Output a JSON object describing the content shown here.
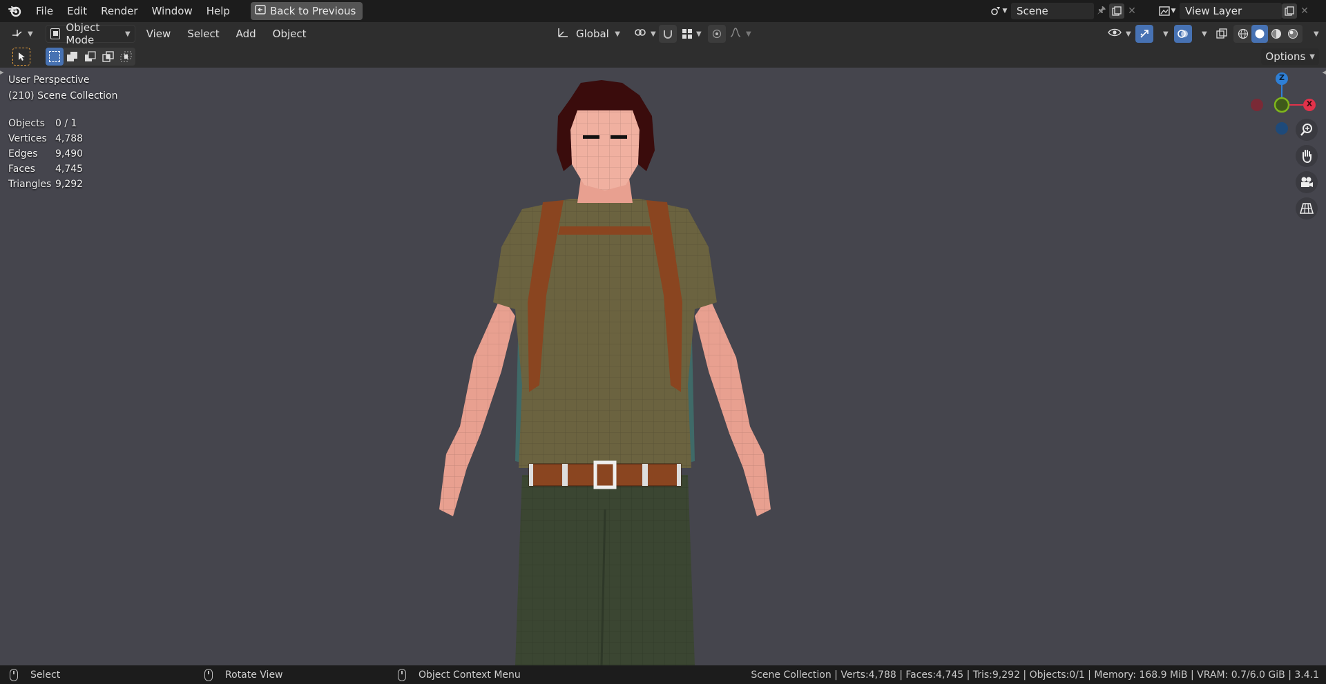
{
  "menu": {
    "items": [
      "File",
      "Edit",
      "Render",
      "Window",
      "Help"
    ],
    "back_label": "Back to Previous"
  },
  "scene": {
    "name": "Scene",
    "view_layer": "View Layer"
  },
  "header": {
    "mode": "Object Mode",
    "menus": [
      "View",
      "Select",
      "Add",
      "Object"
    ],
    "orientation": "Global",
    "options_label": "Options"
  },
  "viewport": {
    "perspective": "User Perspective",
    "collection": "(210) Scene Collection",
    "stats": [
      {
        "k": "Objects",
        "v": "0 / 1"
      },
      {
        "k": "Vertices",
        "v": "4,788"
      },
      {
        "k": "Edges",
        "v": "9,490"
      },
      {
        "k": "Faces",
        "v": "4,745"
      },
      {
        "k": "Triangles",
        "v": "9,292"
      }
    ],
    "gizmo": {
      "z": "Z",
      "x": "X"
    }
  },
  "status": {
    "hint_select": "Select",
    "hint_rotate": "Rotate View",
    "hint_context": "Object Context Menu",
    "info": "Scene Collection | Verts:4,788 | Faces:4,745 | Tris:9,292 | Objects:0/1 | Memory: 168.9 MiB | VRAM: 0.7/6.0 GiB | 3.4.1"
  },
  "colors": {
    "accent": "#4772b3",
    "x_axis": "#e2324a",
    "y_axis": "#7fb61c",
    "z_axis": "#2e7fd6"
  }
}
